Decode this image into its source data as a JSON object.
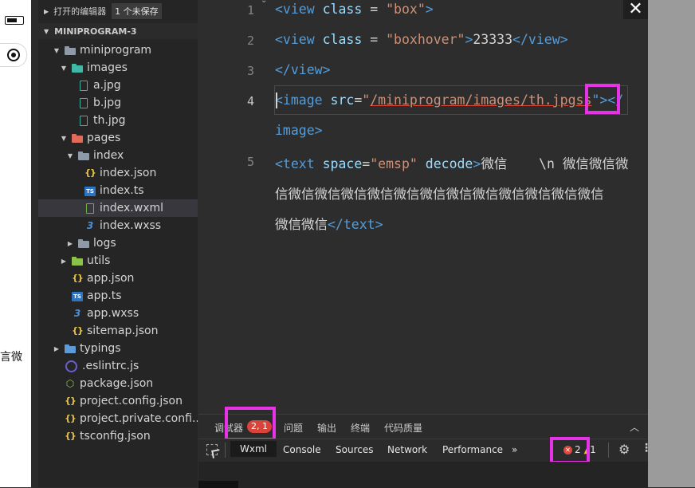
{
  "simulator": {
    "partial_text": "言微"
  },
  "explorer": {
    "open_editors_label": "打开的编辑器",
    "unsaved_badge": "1 个未保存",
    "project_name": "MINIPROGRAM-3",
    "tree": [
      {
        "label": "miniprogram",
        "icon": "folder-icon"
      },
      {
        "label": "images",
        "icon": "images-folder-icon"
      },
      {
        "label": "a.jpg",
        "icon": "image-file-icon"
      },
      {
        "label": "b.jpg",
        "icon": "image-file-icon"
      },
      {
        "label": "th.jpg",
        "icon": "image-file-icon"
      },
      {
        "label": "pages",
        "icon": "pages-folder-icon"
      },
      {
        "label": "index",
        "icon": "folder-icon"
      },
      {
        "label": "index.json",
        "icon": "json-file-icon"
      },
      {
        "label": "index.ts",
        "icon": "ts-file-icon"
      },
      {
        "label": "index.wxml",
        "icon": "wxml-file-icon"
      },
      {
        "label": "index.wxss",
        "icon": "css-file-icon"
      },
      {
        "label": "logs",
        "icon": "folder-icon"
      },
      {
        "label": "utils",
        "icon": "utils-folder-icon"
      },
      {
        "label": "app.json",
        "icon": "json-file-icon"
      },
      {
        "label": "app.ts",
        "icon": "ts-file-icon"
      },
      {
        "label": "app.wxss",
        "icon": "css-file-icon"
      },
      {
        "label": "sitemap.json",
        "icon": "json-file-icon"
      },
      {
        "label": "typings",
        "icon": "ts-folder-icon"
      },
      {
        "label": ".eslintrc.js",
        "icon": "eslint-file-icon"
      },
      {
        "label": "package.json",
        "icon": "package-file-icon"
      },
      {
        "label": "project.config.json",
        "icon": "json-file-icon"
      },
      {
        "label": "project.private.confi...",
        "icon": "json-file-icon"
      },
      {
        "label": "tsconfig.json",
        "icon": "json-file-icon"
      }
    ]
  },
  "editor": {
    "line_numbers": [
      "1",
      "2",
      "3",
      "4",
      "5"
    ],
    "line1": {
      "open": "<view",
      "attr": "class",
      "eq": " = ",
      "value": "\"box\"",
      "close": ">"
    },
    "line2": {
      "open": "<view",
      "attr": "class",
      "eq": " = ",
      "value": "\"boxhover\"",
      "gt": ">",
      "text": "23333",
      "end": "</view>"
    },
    "line3": {
      "end": "</view>"
    },
    "line4": {
      "open": "<image",
      "attr": "src",
      "eq": "=",
      "quote": "\"",
      "path": "/miniprogram/images/th.jpgss",
      "close": "\"></",
      "wrap": "image>"
    },
    "line5": {
      "open": "<text",
      "attr1": "space",
      "eq1": "=",
      "value1": "\"emsp\"",
      "attr2": "decode",
      "gt": ">",
      "text1": "微信    \\n 微信微信微",
      "text2": "信微信微信微信微信微信微信微信微信微信微信微信微信",
      "text3": "微信微信",
      "end": "</text>"
    }
  },
  "panel": {
    "tabs": [
      "调试器",
      "问题",
      "输出",
      "终端",
      "代码质量"
    ],
    "debugger_badge": "2, 1",
    "devtools_tabs": [
      "Wxml",
      "Console",
      "Sources",
      "Network",
      "Performance"
    ],
    "more_tabs": "»",
    "error_count": "2",
    "warning_count": "1"
  },
  "window": {
    "close_label": "✕"
  }
}
